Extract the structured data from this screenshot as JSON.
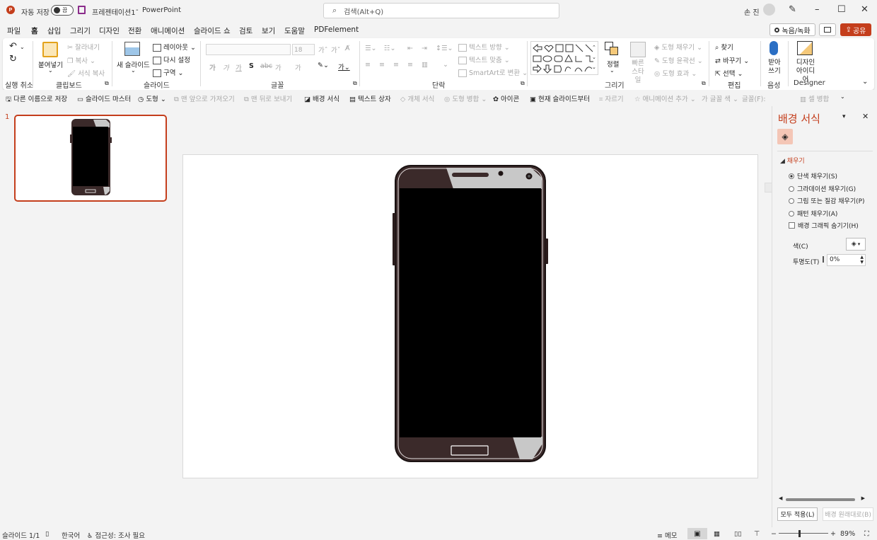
{
  "titlebar": {
    "autosave_label": "자동 저장",
    "autosave_state": "끔",
    "doc_title": "프레젠테이션1",
    "separator": "-",
    "app_name": "PowerPoint",
    "search_placeholder": "검색(Alt+Q)",
    "user_name": "손 진"
  },
  "menu": {
    "tabs": [
      "파일",
      "홈",
      "삽입",
      "그리기",
      "디자인",
      "전환",
      "애니메이션",
      "슬라이드 쇼",
      "검토",
      "보기",
      "도움말",
      "PDFelement"
    ],
    "record_label": "녹음/녹화",
    "share_label": "공유"
  },
  "ribbon": {
    "undo_group": "실행 취소",
    "clipboard": {
      "label": "클립보드",
      "paste": "붙여넣기",
      "cut": "잘라내기",
      "copy": "복사",
      "format_painter": "서식 복사"
    },
    "slides": {
      "label": "슬라이드",
      "new_slide": "새 슬라이드",
      "layout": "레이아웃",
      "reset": "다시 설정",
      "section": "구역"
    },
    "font": {
      "label": "글꼴",
      "size": "18",
      "bold": "가",
      "italic": "가",
      "underline": "가",
      "shadow": "S",
      "strike": "abc",
      "spacing": "가",
      "case": "가"
    },
    "paragraph": {
      "label": "단락",
      "text_direction": "텍스트 방향",
      "align_text": "텍스트 맞춤",
      "smartart": "SmartArt로 변환"
    },
    "drawing": {
      "label": "그리기",
      "arrange": "정렬",
      "quick_styles": "빠른 스타일",
      "shape_fill": "도형 채우기",
      "shape_outline": "도형 윤곽선",
      "shape_effects": "도형 효과"
    },
    "editing": {
      "label": "편집",
      "find": "찾기",
      "replace": "바꾸기",
      "select": "선택"
    },
    "voice": {
      "label": "음성",
      "dictate": "받아 쓰기"
    },
    "designer": {
      "label": "Designer",
      "ideas": "디자인 아이디어"
    }
  },
  "qat": {
    "items": [
      "다른 이름으로 저장",
      "슬라이드 마스터",
      "도형",
      "맨 앞으로 가져오기",
      "맨 뒤로 보내기",
      "배경 서식",
      "텍스트 상자",
      "개체 서식",
      "도형 병합",
      "아이콘",
      "현재 슬라이드부터",
      "자르기",
      "애니메이션 추가",
      "글꼴 색",
      "글꼴(F):",
      "셀 병합"
    ]
  },
  "thumbnails": {
    "slide_number": "1"
  },
  "format_pane": {
    "title": "배경 서식",
    "section": "채우기",
    "options": [
      "단색 채우기(S)",
      "그라데이션 채우기(G)",
      "그림 또는 질감 채우기(P)",
      "패턴 채우기(A)"
    ],
    "hide_bg_graphics": "배경 그래픽 숨기기(H)",
    "color_label": "색(C)",
    "transparency_label": "투명도(T)",
    "transparency_value": "0%",
    "apply_all": "모두 적용(L)",
    "reset_bg": "배경 원래대로(B)"
  },
  "statusbar": {
    "slide_info": "슬라이드 1/1",
    "language": "한국어",
    "accessibility": "접근성: 조사 필요",
    "notes": "메모",
    "zoom": "89%"
  },
  "colors": {
    "accent": "#c43e1c",
    "phone_body": "#3b2a2a",
    "screen": "#000000"
  }
}
